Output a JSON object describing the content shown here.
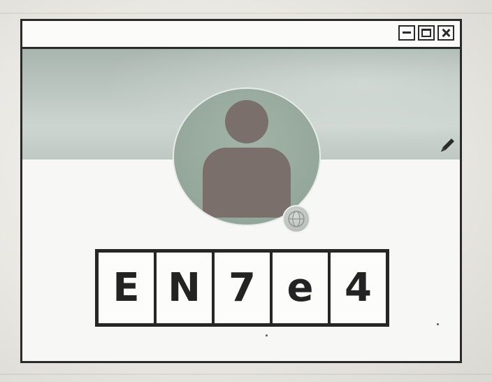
{
  "window": {
    "controls": [
      {
        "name": "minimize",
        "icon": "minimize-icon"
      },
      {
        "name": "maximize",
        "icon": "maximize-icon"
      },
      {
        "name": "close",
        "icon": "close-icon"
      }
    ]
  },
  "profile": {
    "avatar_icon": "user-silhouette-icon",
    "badge_icon": "globe-icon",
    "edit_icon": "pencil-icon"
  },
  "captcha": {
    "characters": [
      "E",
      "N",
      "7",
      "e",
      "4"
    ]
  },
  "colors": {
    "frame": "#2a2a2a",
    "cover": "#b5c1ba",
    "avatar_bg": "#97a99d",
    "silhouette": "#7b6f6b"
  }
}
